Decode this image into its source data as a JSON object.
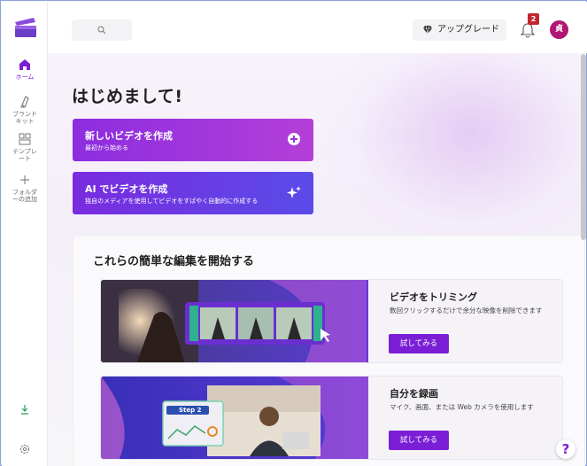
{
  "sidebar": {
    "items": [
      {
        "label": "ホーム",
        "icon": "home-icon"
      },
      {
        "label": "ブランド キット",
        "icon": "brand-kit-icon"
      },
      {
        "label": "テンプレート",
        "icon": "template-icon"
      },
      {
        "label": "フォルダーの追加",
        "icon": "plus-icon"
      }
    ],
    "bottom_icons": [
      "download-icon",
      "settings-icon"
    ]
  },
  "topbar": {
    "search_icon": "search-icon",
    "upgrade_label": "アップグレード",
    "notification_count": "2",
    "avatar_initial": "貞"
  },
  "main": {
    "greeting": "はじめまして!",
    "cta_new": {
      "title": "新しいビデオを作成",
      "subtitle": "最初から始める"
    },
    "cta_ai": {
      "title": "AI でビデオを作成",
      "subtitle": "独自のメディアを使用してビデオをすばやく自動的に作成する"
    },
    "section_title": "これらの簡単な編集を開始する",
    "cards": [
      {
        "title": "ビデオをトリミング",
        "description": "数回クリックするだけで余分な映像を削除できます",
        "button": "試してみる"
      },
      {
        "title": "自分を録画",
        "description": "マイク、画面、または Web カメラを使用します",
        "button": "試してみる",
        "thumb_label": "Step 2"
      }
    ]
  },
  "help_label": "?",
  "colors": {
    "accent": "#7a1fd6",
    "cta1": "#9b33dd",
    "cta2": "#6640e6",
    "badge": "#c4262e",
    "avatar": "#b01673"
  }
}
